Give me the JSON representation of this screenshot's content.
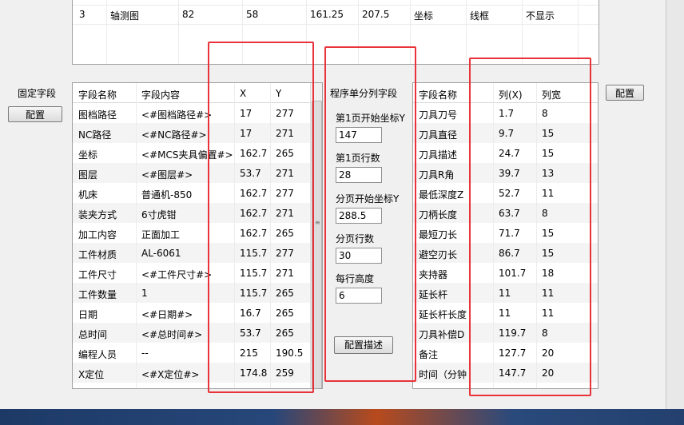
{
  "top_table": {
    "row": {
      "index": "3",
      "name": "轴测图",
      "c3": "82",
      "c4": "58",
      "c5": "161.25",
      "c6": "207.5",
      "c7": "坐标",
      "c8": "线框",
      "c9": "不显示"
    }
  },
  "fixed_fields": {
    "section_label": "固定字段",
    "config_button": "配置",
    "headers": {
      "name": "字段名称",
      "content": "字段内容",
      "x": "X",
      "y": "Y"
    },
    "rows": [
      {
        "name": "图档路径",
        "content": "<#图档路径#>",
        "x": "17",
        "y": "277"
      },
      {
        "name": "NC路径",
        "content": "<#NC路径#>",
        "x": "17",
        "y": "271"
      },
      {
        "name": "坐标",
        "content": "<#MCS夹具偏置#>",
        "x": "162.7",
        "y": "265"
      },
      {
        "name": "图层",
        "content": "<#图层#>",
        "x": "53.7",
        "y": "271"
      },
      {
        "name": "机床",
        "content": "普通机-850",
        "x": "162.7",
        "y": "277"
      },
      {
        "name": "装夹方式",
        "content": "6寸虎钳",
        "x": "162.7",
        "y": "271"
      },
      {
        "name": "加工内容",
        "content": "正面加工",
        "x": "162.7",
        "y": "265"
      },
      {
        "name": "工件材质",
        "content": "AL-6061",
        "x": "115.7",
        "y": "277"
      },
      {
        "name": "工件尺寸",
        "content": "<#工件尺寸#>",
        "x": "115.7",
        "y": "271"
      },
      {
        "name": "工件数量",
        "content": "1",
        "x": "115.7",
        "y": "265"
      },
      {
        "name": "日期",
        "content": "<#日期#>",
        "x": "16.7",
        "y": "265"
      },
      {
        "name": "总时间",
        "content": "<#总时间#>",
        "x": "53.7",
        "y": "265"
      },
      {
        "name": "编程人员",
        "content": "--",
        "x": "215",
        "y": "190.5"
      },
      {
        "name": "X定位",
        "content": "<#X定位#>",
        "x": "174.8",
        "y": "259"
      }
    ]
  },
  "paging": {
    "title": "程序单分列字段",
    "page1_start_y_label": "第1页开始坐标Y",
    "page1_start_y": "147",
    "page1_rows_label": "第1页行数",
    "page1_rows": "28",
    "split_start_y_label": "分页开始坐标Y",
    "split_start_y": "288.5",
    "split_rows_label": "分页行数",
    "split_rows": "30",
    "row_height_label": "每行高度",
    "row_height": "6",
    "config_desc_button": "配置描述"
  },
  "column_fields": {
    "config_button": "配置",
    "headers": {
      "name": "字段名称",
      "col": "列(X)",
      "width": "列宽"
    },
    "rows": [
      {
        "name": "刀具刀号",
        "col": "1.7",
        "width": "8"
      },
      {
        "name": "刀具直径",
        "col": "9.7",
        "width": "15"
      },
      {
        "name": "刀具描述",
        "col": "24.7",
        "width": "15"
      },
      {
        "name": "刀具R角",
        "col": "39.7",
        "width": "13"
      },
      {
        "name": "最低深度Z",
        "col": "52.7",
        "width": "11"
      },
      {
        "name": "刀柄长度",
        "col": "63.7",
        "width": "8"
      },
      {
        "name": "最短刀长",
        "col": "71.7",
        "width": "15"
      },
      {
        "name": "避空刃长",
        "col": "86.7",
        "width": "15"
      },
      {
        "name": "夹持器",
        "col": "101.7",
        "width": "18"
      },
      {
        "name": "延长杆",
        "col": "11",
        "width": "11"
      },
      {
        "name": "延长杆长度",
        "col": "11",
        "width": "11"
      },
      {
        "name": "刀具补偿D",
        "col": "119.7",
        "width": "8"
      },
      {
        "name": "备注",
        "col": "127.7",
        "width": "20"
      },
      {
        "name": "时间（分钟",
        "col": "147.7",
        "width": "20"
      }
    ]
  },
  "colors": {
    "highlight_box": "#e8333b"
  }
}
